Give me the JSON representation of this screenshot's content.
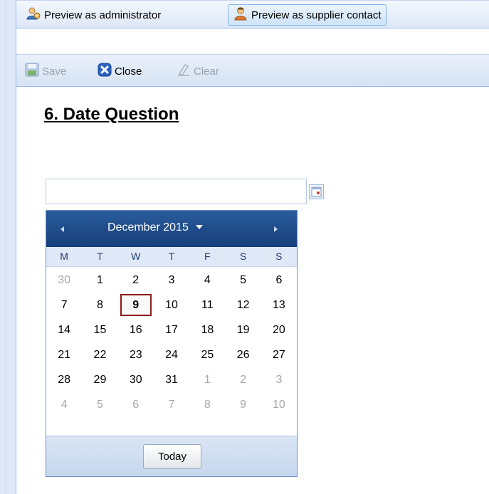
{
  "toolbar_top": {
    "preview_admin": "Preview as administrator",
    "preview_supplier": "Preview as supplier contact"
  },
  "toolbar_actions": {
    "save": "Save",
    "close": "Close",
    "clear": "Clear"
  },
  "question": {
    "title": "6. Date Question",
    "value": ""
  },
  "calendar": {
    "month_label": "December 2015",
    "weekdays": [
      "M",
      "T",
      "W",
      "T",
      "F",
      "S",
      "S"
    ],
    "days": [
      {
        "d": "30",
        "other": true
      },
      {
        "d": "1"
      },
      {
        "d": "2"
      },
      {
        "d": "3"
      },
      {
        "d": "4"
      },
      {
        "d": "5"
      },
      {
        "d": "6"
      },
      {
        "d": "7"
      },
      {
        "d": "8"
      },
      {
        "d": "9",
        "today": true
      },
      {
        "d": "10"
      },
      {
        "d": "11"
      },
      {
        "d": "12"
      },
      {
        "d": "13"
      },
      {
        "d": "14"
      },
      {
        "d": "15"
      },
      {
        "d": "16"
      },
      {
        "d": "17"
      },
      {
        "d": "18"
      },
      {
        "d": "19"
      },
      {
        "d": "20"
      },
      {
        "d": "21"
      },
      {
        "d": "22"
      },
      {
        "d": "23"
      },
      {
        "d": "24"
      },
      {
        "d": "25"
      },
      {
        "d": "26"
      },
      {
        "d": "27"
      },
      {
        "d": "28"
      },
      {
        "d": "29"
      },
      {
        "d": "30"
      },
      {
        "d": "31"
      },
      {
        "d": "1",
        "other": true
      },
      {
        "d": "2",
        "other": true
      },
      {
        "d": "3",
        "other": true
      },
      {
        "d": "4",
        "other": true
      },
      {
        "d": "5",
        "other": true
      },
      {
        "d": "6",
        "other": true
      },
      {
        "d": "7",
        "other": true
      },
      {
        "d": "8",
        "other": true
      },
      {
        "d": "9",
        "other": true
      },
      {
        "d": "10",
        "other": true
      }
    ],
    "today_label": "Today"
  },
  "icons": {
    "admin": "admin-user-icon",
    "supplier": "supplier-contact-icon",
    "save": "save-disk-icon",
    "close": "close-x-icon",
    "clear": "eraser-icon",
    "calendar_trigger": "calendar-icon",
    "prev": "chevron-left-icon",
    "next": "chevron-right-icon",
    "month_dropdown": "caret-down-icon"
  },
  "colors": {
    "accent_blue": "#15428b",
    "calendar_header": "#1f4d8c",
    "today_border": "#8b1c1c"
  }
}
